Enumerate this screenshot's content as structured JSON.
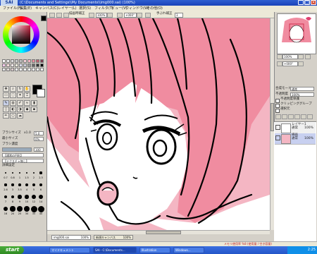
{
  "window": {
    "app_logo": "SAI",
    "title": "(C:\\Documents and Settings\\\\My Documents\\\\img000.sai) (100%)",
    "min_label": "_",
    "max_label": "□",
    "close_label": "×"
  },
  "menu": {
    "items": [
      "ファイル(F)",
      "編集(E)",
      "キャンバス(C)",
      "レイヤー(L)",
      "選択(S)",
      "フィルタ(T)",
      "ビュー(V)",
      "ウィンドウ(W)",
      "その他(O)"
    ]
  },
  "toolbar": {
    "antialias_label": "描画時補正",
    "zoom_value": "100%",
    "angle_value": "+000°",
    "stabilizer_label": "手ぶれ補正",
    "stabilizer_value": "3"
  },
  "left_panel": {
    "brush_size_label": "ブラシサイズ",
    "brush_size_multiplier": "x1.0",
    "brush_size_value": "5.0",
    "min_size_label": "最小サイズ",
    "min_size_value": "0%",
    "density_label": "ブラシ濃度",
    "density_value": "100",
    "density_fraction": 1.0,
    "shape_label": "【通常の円形】",
    "texture_label": "【テクスチャ無し】",
    "detail_label": "詳細設定",
    "brush_sizes": [
      "0.7",
      "0.8",
      "1",
      "1.5",
      "2",
      "2.3",
      "2.6",
      "3",
      "3.5",
      "4",
      "5",
      "6",
      "7",
      "8",
      "9",
      "10",
      "12",
      "14",
      "16",
      "20",
      "25",
      "30",
      "35",
      "40"
    ]
  },
  "right_panel": {
    "blend_mode_label": "合成モード",
    "blend_mode_value": "通常",
    "opacity_label": "不透明度",
    "opacity_value": "100%",
    "protect_label": "不透明度保護",
    "clip_label": "クリッピンググループ",
    "select_source_label": "選択元",
    "layers": [
      {
        "name": "レイヤー1",
        "mode": "通常",
        "opacity": "100%"
      },
      {
        "name": "線画",
        "mode": "通常",
        "opacity": "100%"
      }
    ]
  },
  "doc_tabs": [
    {
      "name": "img000.sai",
      "zoom": "100%"
    },
    {
      "name": "新規キャンバス",
      "zoom": "100%"
    }
  ],
  "status": {
    "memory_text": "メモリ使用率 %8 (使用量 / 空き容量)"
  },
  "taskbar": {
    "start_label": "start",
    "tasks": [
      "マイドキュメント",
      "SAI - C:\\Documents...",
      "Illustration",
      "Windows..."
    ],
    "clock": "2:25"
  },
  "colors": {
    "canvas_bg": "#f4b6c3",
    "hair": "#f08ca0",
    "title_bar": "#1942b8",
    "taskbar": "#2456c8"
  }
}
